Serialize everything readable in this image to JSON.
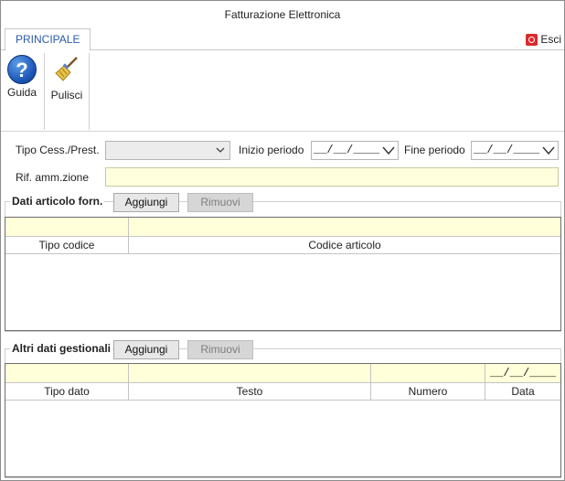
{
  "window": {
    "title": "Fatturazione Elettronica"
  },
  "tabs": [
    {
      "label": "PRINCIPALE",
      "active": true
    }
  ],
  "esci": {
    "label": "Esci"
  },
  "ribbon": {
    "guida": {
      "label": "Guida",
      "icon": "help-icon"
    },
    "pulisci": {
      "label": "Pulisci",
      "icon": "broom-icon"
    }
  },
  "form": {
    "tipo_cess_label": "Tipo Cess./Prest.",
    "tipo_cess_value": "",
    "inizio_periodo_label": "Inizio periodo",
    "inizio_periodo_value": "__/__/____",
    "fine_periodo_label": "Fine periodo",
    "fine_periodo_value": "__/__/____",
    "rif_label": "Rif. amm.zione",
    "rif_value": ""
  },
  "dati_articolo": {
    "title": "Dati articolo forn.",
    "add_label": "Aggiungi",
    "remove_label": "Rimuovi",
    "columns": [
      "Tipo codice",
      "Codice articolo"
    ],
    "rows": []
  },
  "altri_dati": {
    "title": "Altri dati gestionali",
    "add_label": "Aggiungi",
    "remove_label": "Rimuovi",
    "columns": [
      "Tipo dato",
      "Testo",
      "Numero",
      "Data"
    ],
    "date_filter": "__/__/____",
    "rows": []
  },
  "colors": {
    "accent": "#2a5ba8",
    "filter_bg": "#ffffda",
    "input_bg": "#ffffde",
    "esci_red": "#d92b2b"
  }
}
